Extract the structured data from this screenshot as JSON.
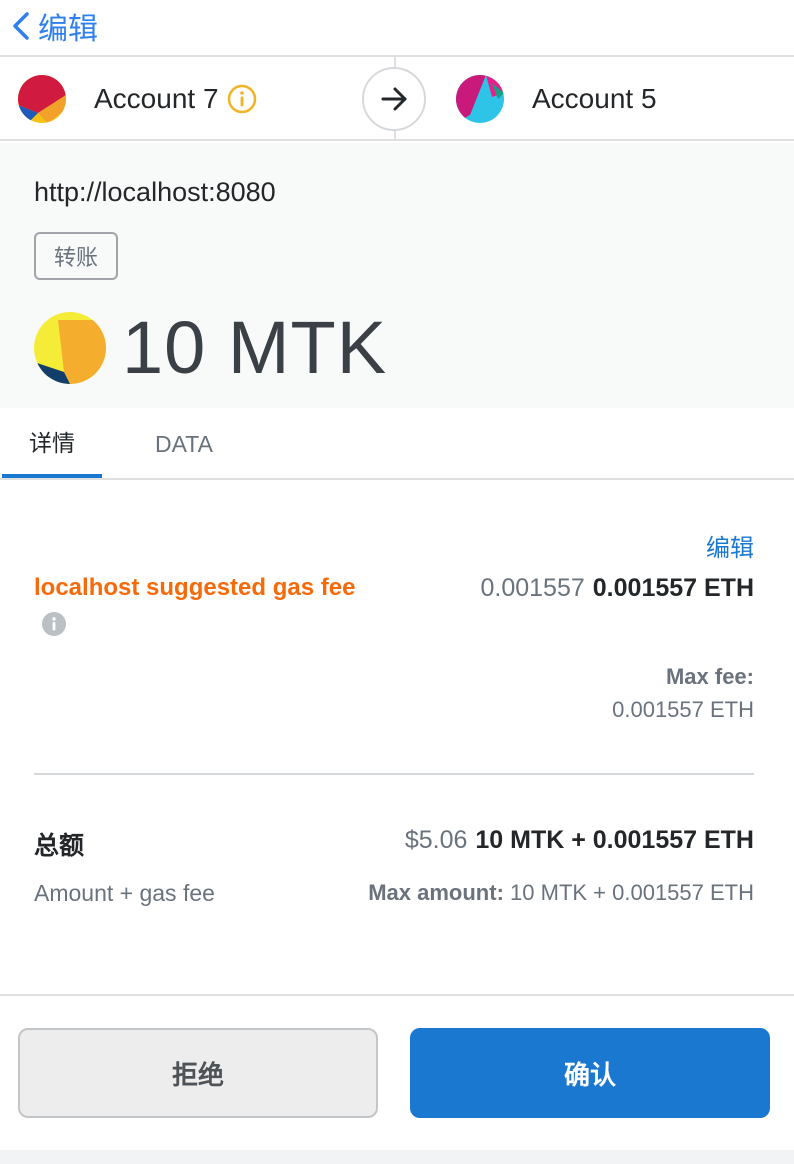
{
  "header": {
    "back_label": "编辑"
  },
  "accounts": {
    "from_name": "Account 7",
    "to_name": "Account 5"
  },
  "summary": {
    "origin": "http://localhost:8080",
    "type_badge": "转账",
    "amount": "10 MTK"
  },
  "tabs": [
    {
      "label": "详情",
      "active": true
    },
    {
      "label": "DATA",
      "active": false
    }
  ],
  "gas": {
    "edit_label": "编辑",
    "label": "localhost suggested gas fee",
    "secondary_value": "0.001557",
    "primary_value": "0.001557 ETH",
    "max_fee_label": "Max fee:",
    "max_fee_value": "0.001557 ETH"
  },
  "total": {
    "label": "总额",
    "secondary_value": "$5.06",
    "primary_value": "10 MTK + 0.001557 ETH",
    "sub_label": "Amount + gas fee",
    "max_amount_label": "Max amount:",
    "max_amount_value": "10 MTK + 0.001557 ETH"
  },
  "buttons": {
    "reject": "拒绝",
    "confirm": "确认"
  },
  "colors": {
    "accent": "#1b78d0",
    "warning": "#f66a0a",
    "info_yellow": "#f0b429"
  },
  "icons": {
    "back": "chevron-left-icon",
    "info": "info-icon",
    "arrow": "arrow-right-icon"
  }
}
